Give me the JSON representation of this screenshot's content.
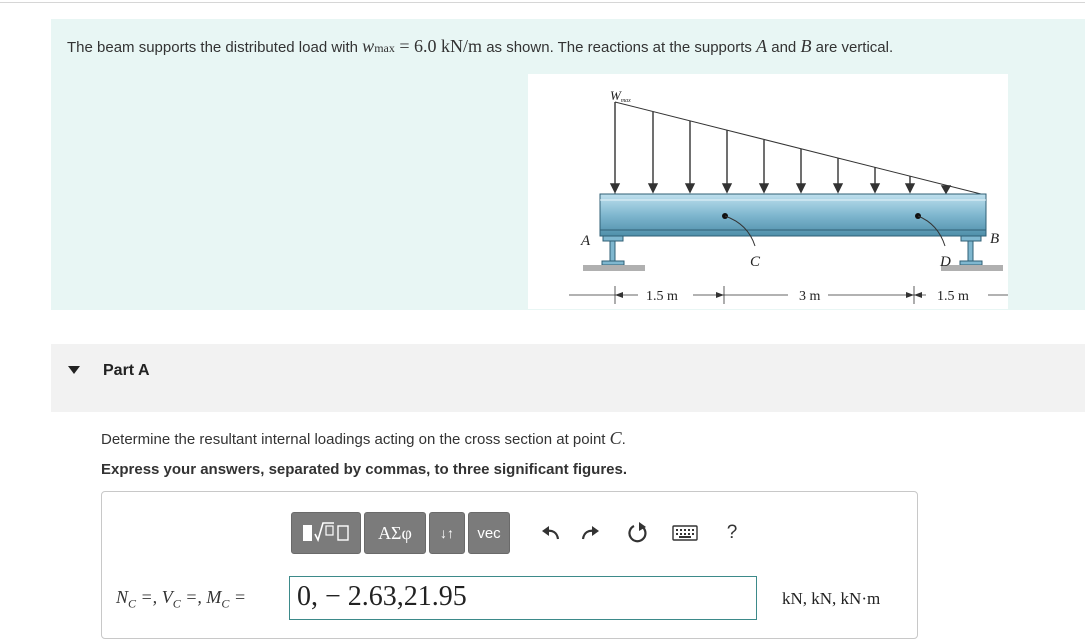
{
  "problem": {
    "text_before": "The beam supports the distributed load with ",
    "wmax_symbol": "w",
    "wmax_sub": "max",
    "equals": " = ",
    "wmax_value": "6.0 kN/m",
    "text_mid": " as shown. The reactions at the supports ",
    "support_a": "A",
    "text_and": " and ",
    "support_b": "B",
    "text_end": " are vertical."
  },
  "figure": {
    "load_label": "W",
    "load_sub": "max",
    "label_a": "A",
    "label_b": "B",
    "label_c": "C",
    "label_d": "D",
    "dim_1": "1.5 m",
    "dim_2": "3 m",
    "dim_3": "1.5 m"
  },
  "part": {
    "title": "Part A"
  },
  "question": {
    "text": "Determine the resultant internal loadings acting on the cross section at point ",
    "point": "C",
    "period": "."
  },
  "instruction": "Express your answers, separated by commas, to three significant figures.",
  "toolbar": {
    "greek_label": "ΑΣφ",
    "arrows_label": "↓↑",
    "vec_label": "vec",
    "help_label": "?"
  },
  "answer": {
    "label": "N",
    "label_full": "NC =, VC =, MC =",
    "value": "0, − 2.63,21.95",
    "units": "kN, kN, kN·m"
  },
  "icons": {
    "template": "template-icon",
    "undo": "undo-icon",
    "redo": "redo-icon",
    "reset": "reset-icon",
    "keyboard": "keyboard-icon",
    "help": "help-icon"
  },
  "colors": {
    "problem_bg": "#e8f6f4",
    "beam": "#7fb7cf",
    "toolbar_btn": "#7b7b7b",
    "input_border": "#3d8a8a"
  }
}
